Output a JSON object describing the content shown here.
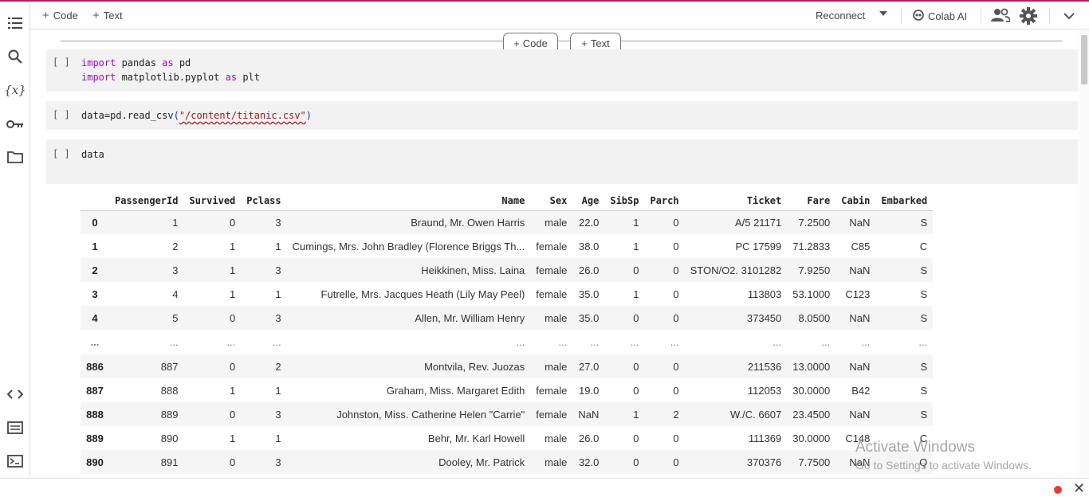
{
  "toolbar": {
    "code_label": "Code",
    "text_label": "Text",
    "reconnect_label": "Reconnect",
    "colab_ai_label": "Colab AI"
  },
  "add_cell": {
    "code_label": "Code",
    "text_label": "Text"
  },
  "cells": [
    {
      "run_label": "[ ]",
      "lines": [
        [
          {
            "t": "import",
            "c": "kw"
          },
          {
            "t": " pandas ",
            "c": ""
          },
          {
            "t": "as",
            "c": "kw"
          },
          {
            "t": " pd",
            "c": ""
          }
        ],
        [
          {
            "t": "import",
            "c": "kw"
          },
          {
            "t": " matplotlib.pyplot ",
            "c": ""
          },
          {
            "t": "as",
            "c": "kw"
          },
          {
            "t": " plt",
            "c": ""
          }
        ]
      ]
    },
    {
      "run_label": "[ ]",
      "lines": [
        [
          {
            "t": "data=pd.read_csv",
            "c": ""
          },
          {
            "t": "(",
            "c": "paren"
          },
          {
            "t": "\"/content/titanic.csv\"",
            "c": "str"
          },
          {
            "t": ")",
            "c": "paren"
          }
        ]
      ]
    },
    {
      "run_label": "[ ]",
      "lines": [
        [
          {
            "t": "data",
            "c": ""
          }
        ]
      ]
    }
  ],
  "dataframe": {
    "columns": [
      "",
      "PassengerId",
      "Survived",
      "Pclass",
      "Name",
      "Sex",
      "Age",
      "SibSp",
      "Parch",
      "Ticket",
      "Fare",
      "Cabin",
      "Embarked"
    ],
    "rows": [
      [
        "0",
        "1",
        "0",
        "3",
        "Braund, Mr. Owen Harris",
        "male",
        "22.0",
        "1",
        "0",
        "A/5 21171",
        "7.2500",
        "NaN",
        "S"
      ],
      [
        "1",
        "2",
        "1",
        "1",
        "Cumings, Mrs. John Bradley (Florence Briggs Th...",
        "female",
        "38.0",
        "1",
        "0",
        "PC 17599",
        "71.2833",
        "C85",
        "C"
      ],
      [
        "2",
        "3",
        "1",
        "3",
        "Heikkinen, Miss. Laina",
        "female",
        "26.0",
        "0",
        "0",
        "STON/O2. 3101282",
        "7.9250",
        "NaN",
        "S"
      ],
      [
        "3",
        "4",
        "1",
        "1",
        "Futrelle, Mrs. Jacques Heath (Lily May Peel)",
        "female",
        "35.0",
        "1",
        "0",
        "113803",
        "53.1000",
        "C123",
        "S"
      ],
      [
        "4",
        "5",
        "0",
        "3",
        "Allen, Mr. William Henry",
        "male",
        "35.0",
        "0",
        "0",
        "373450",
        "8.0500",
        "NaN",
        "S"
      ],
      [
        "...",
        "...",
        "...",
        "...",
        "...",
        "...",
        "...",
        "...",
        "...",
        "...",
        "...",
        "...",
        "..."
      ],
      [
        "886",
        "887",
        "0",
        "2",
        "Montvila, Rev. Juozas",
        "male",
        "27.0",
        "0",
        "0",
        "211536",
        "13.0000",
        "NaN",
        "S"
      ],
      [
        "887",
        "888",
        "1",
        "1",
        "Graham, Miss. Margaret Edith",
        "female",
        "19.0",
        "0",
        "0",
        "112053",
        "30.0000",
        "B42",
        "S"
      ],
      [
        "888",
        "889",
        "0",
        "3",
        "Johnston, Miss. Catherine Helen \"Carrie\"",
        "female",
        "NaN",
        "1",
        "2",
        "W./C. 6607",
        "23.4500",
        "NaN",
        "S"
      ],
      [
        "889",
        "890",
        "1",
        "1",
        "Behr, Mr. Karl Howell",
        "male",
        "26.0",
        "0",
        "0",
        "111369",
        "30.0000",
        "C148",
        "C"
      ],
      [
        "890",
        "891",
        "0",
        "3",
        "Dooley, Mr. Patrick",
        "male",
        "32.0",
        "0",
        "0",
        "370376",
        "7.7500",
        "NaN",
        "Q"
      ]
    ]
  },
  "watermark": {
    "line1": "Activate Windows",
    "line2": "Go to Settings to activate Windows."
  },
  "colors": {
    "top_accent": "#c2185b",
    "keyword": "#af00db",
    "string": "#a31515",
    "record_dot": "#e53935"
  },
  "icons": [
    "table-of-contents-icon",
    "search-icon",
    "variables-icon",
    "key-icon",
    "folder-icon",
    "code-snippets-icon",
    "command-palette-icon",
    "terminal-icon",
    "colab-ai-icon",
    "share-people-icon",
    "gear-icon",
    "chevron-down-icon",
    "close-icon"
  ]
}
